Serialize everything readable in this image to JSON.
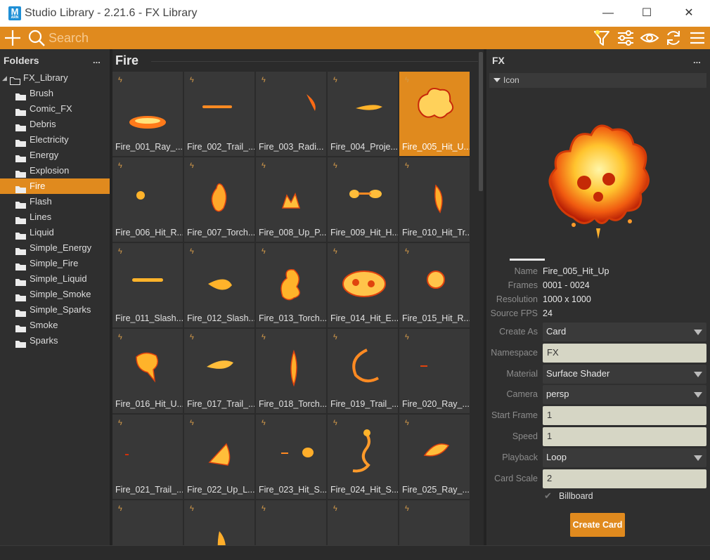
{
  "window": {
    "app_icon_letter": "M",
    "app_icon_sub": "ARN",
    "title": "Studio Library - 2.21.6 - FX Library",
    "minimize": "—",
    "maximize": "☐",
    "close": "✕"
  },
  "toolbar": {
    "search_placeholder": "Search",
    "icons": [
      "add-icon",
      "search-icon",
      "filter-icon",
      "settings-sliders-icon",
      "eye-icon",
      "refresh-icon",
      "menu-icon"
    ],
    "accent_color": "#e08a1e"
  },
  "folders": {
    "title": "Folders",
    "menu": "...",
    "root": "FX_Library",
    "items": [
      "Brush",
      "Comic_FX",
      "Debris",
      "Electricity",
      "Energy",
      "Explosion",
      "Fire",
      "Flash",
      "Lines",
      "Liquid",
      "Simple_Energy",
      "Simple_Fire",
      "Simple_Liquid",
      "Simple_Smoke",
      "Simple_Sparks",
      "Smoke",
      "Sparks"
    ],
    "selected": "Fire"
  },
  "grid": {
    "title": "Fire",
    "selected": "Fire_005_Hit_U...",
    "tiles": [
      "Fire_001_Ray_...",
      "Fire_002_Trail_...",
      "Fire_003_Radi...",
      "Fire_004_Proje...",
      "Fire_005_Hit_U...",
      "Fire_006_Hit_R...",
      "Fire_007_Torch...",
      "Fire_008_Up_P...",
      "Fire_009_Hit_H...",
      "Fire_010_Hit_Tr...",
      "Fire_011_Slash...",
      "Fire_012_Slash...",
      "Fire_013_Torch...",
      "Fire_014_Hit_E...",
      "Fire_015_Hit_R...",
      "Fire_016_Hit_U...",
      "Fire_017_Trail_...",
      "Fire_018_Torch...",
      "Fire_019_Trail_...",
      "Fire_020_Ray_...",
      "Fire_021_Trail_...",
      "Fire_022_Up_L...",
      "Fire_023_Hit_S...",
      "Fire_024_Hit_S...",
      "Fire_025_Ray_...",
      "",
      "",
      "",
      "",
      ""
    ]
  },
  "details": {
    "title": "FX",
    "menu": "...",
    "section": "Icon",
    "info": [
      {
        "key": "Name",
        "value": "Fire_005_Hit_Up"
      },
      {
        "key": "Frames",
        "value": "0001 - 0024"
      },
      {
        "key": "Resolution",
        "value": "1000 x 1000"
      },
      {
        "key": "Source FPS",
        "value": "24"
      }
    ],
    "create_as": {
      "label": "Create As",
      "value": "Card"
    },
    "namespace": {
      "label": "Namespace",
      "value": "FX"
    },
    "material": {
      "label": "Material",
      "value": "Surface Shader"
    },
    "camera": {
      "label": "Camera",
      "value": "persp"
    },
    "start_frame": {
      "label": "Start Frame",
      "value": "1"
    },
    "speed": {
      "label": "Speed",
      "value": "1"
    },
    "playback": {
      "label": "Playback",
      "value": "Loop"
    },
    "card_scale": {
      "label": "Card Scale",
      "value": "2"
    },
    "billboard": {
      "label": "Billboard",
      "checked": true
    },
    "create_button": "Create Card"
  }
}
